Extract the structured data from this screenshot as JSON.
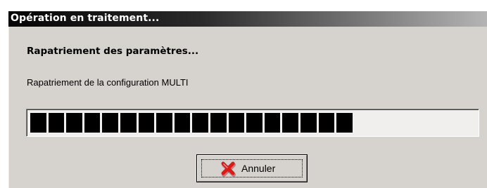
{
  "window": {
    "title": "Opération en traitement..."
  },
  "content": {
    "heading": "Rapatriement des paramètres...",
    "status": "Rapatriement de la configuration MULTI"
  },
  "progress": {
    "filled_blocks": 18,
    "total_blocks": 25,
    "fraction": 0.72,
    "bar_color": "#000000",
    "track_color": "#f0efed"
  },
  "buttons": {
    "cancel": {
      "label": "Annuler",
      "icon": "red-x-icon",
      "icon_color": "#e01818"
    }
  },
  "colors": {
    "dialog_background": "#d6d3ce",
    "titlebar_start": "#050505",
    "titlebar_end": "#b4b4b4",
    "title_text": "#ffffff"
  }
}
